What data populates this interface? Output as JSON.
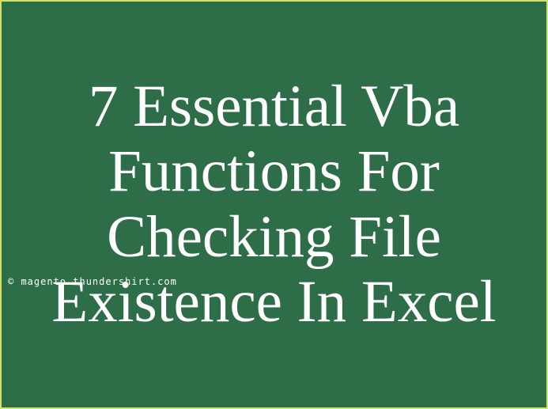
{
  "title": "7 Essential Vba Functions For Checking File Existence In Excel",
  "watermark": "© magento.thundershirt.com"
}
